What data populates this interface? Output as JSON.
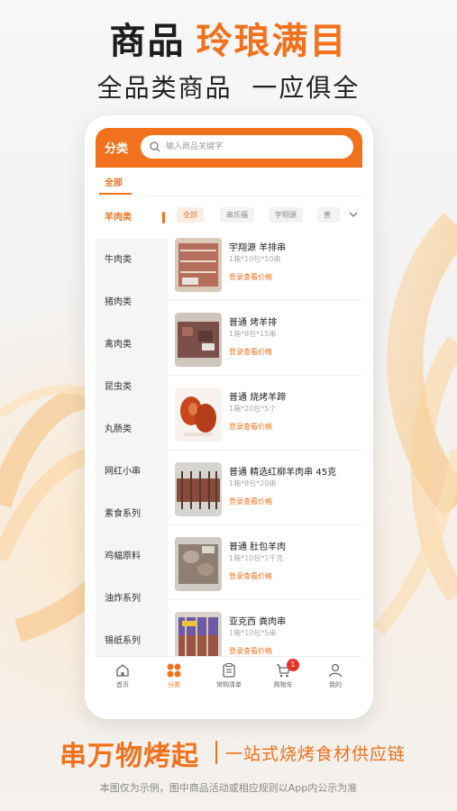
{
  "promo": {
    "headline_dark": "商品",
    "headline_accent": "玲琅满目",
    "subline": "全品类商品  一应俱全",
    "slogan_main": "串万物烤起",
    "slogan_sub": "一站式烧烤食材供应链",
    "disclaimer": "本图仅为示例，图中商品活动或相应规则以App内公示为准"
  },
  "app": {
    "title": "分类",
    "search_placeholder": "输入商品关键字",
    "top_tab": "全部",
    "accent_color": "#f2711c"
  },
  "sidebar": {
    "items": [
      {
        "label": "羊肉类",
        "active": true
      },
      {
        "label": "牛肉类"
      },
      {
        "label": "猪肉类"
      },
      {
        "label": "禽肉类"
      },
      {
        "label": "昆虫类"
      },
      {
        "label": "丸肠类"
      },
      {
        "label": "网红小串"
      },
      {
        "label": "素食系列"
      },
      {
        "label": "鸡幅原料"
      },
      {
        "label": "油炸系列"
      },
      {
        "label": "锡纸系列"
      }
    ]
  },
  "filters": {
    "chips": [
      "全部",
      "串乐福",
      "宇翔源",
      "普"
    ]
  },
  "products": [
    {
      "name": "宇翔源 羊排串",
      "spec": "1箱*10包*10串",
      "login": "登录查看价格",
      "icon": "lamb-chop-skewer"
    },
    {
      "name": "普通 烤羊排",
      "spec": "1箱*8包*15串",
      "login": "登录查看价格",
      "icon": "roast-lamb-rib"
    },
    {
      "name": "普通 烧烤羊蹄",
      "spec": "1箱*20包*5个",
      "login": "登录查看价格",
      "icon": "lamb-trotter"
    },
    {
      "name": "普通 精选红柳羊肉串 45克",
      "spec": "1箱*8包*20串",
      "login": "登录查看价格",
      "icon": "red-willow-skewer"
    },
    {
      "name": "普通 肚包羊肉",
      "spec": "1箱*10包*1千克",
      "login": "登录查看价格",
      "icon": "tripe-wrapped-lamb"
    },
    {
      "name": "亚克西 粪肉串",
      "spec": "1箱*10包*5串",
      "login": "登录查看价格",
      "icon": "lamb-skewer-pack"
    }
  ],
  "bottom_nav": {
    "items": [
      {
        "label": "首页",
        "icon": "home-icon"
      },
      {
        "label": "分类",
        "icon": "category-icon",
        "active": true
      },
      {
        "label": "常购清单",
        "icon": "list-icon"
      },
      {
        "label": "购物车",
        "icon": "cart-icon",
        "badge": "1"
      },
      {
        "label": "我的",
        "icon": "user-icon"
      }
    ]
  }
}
